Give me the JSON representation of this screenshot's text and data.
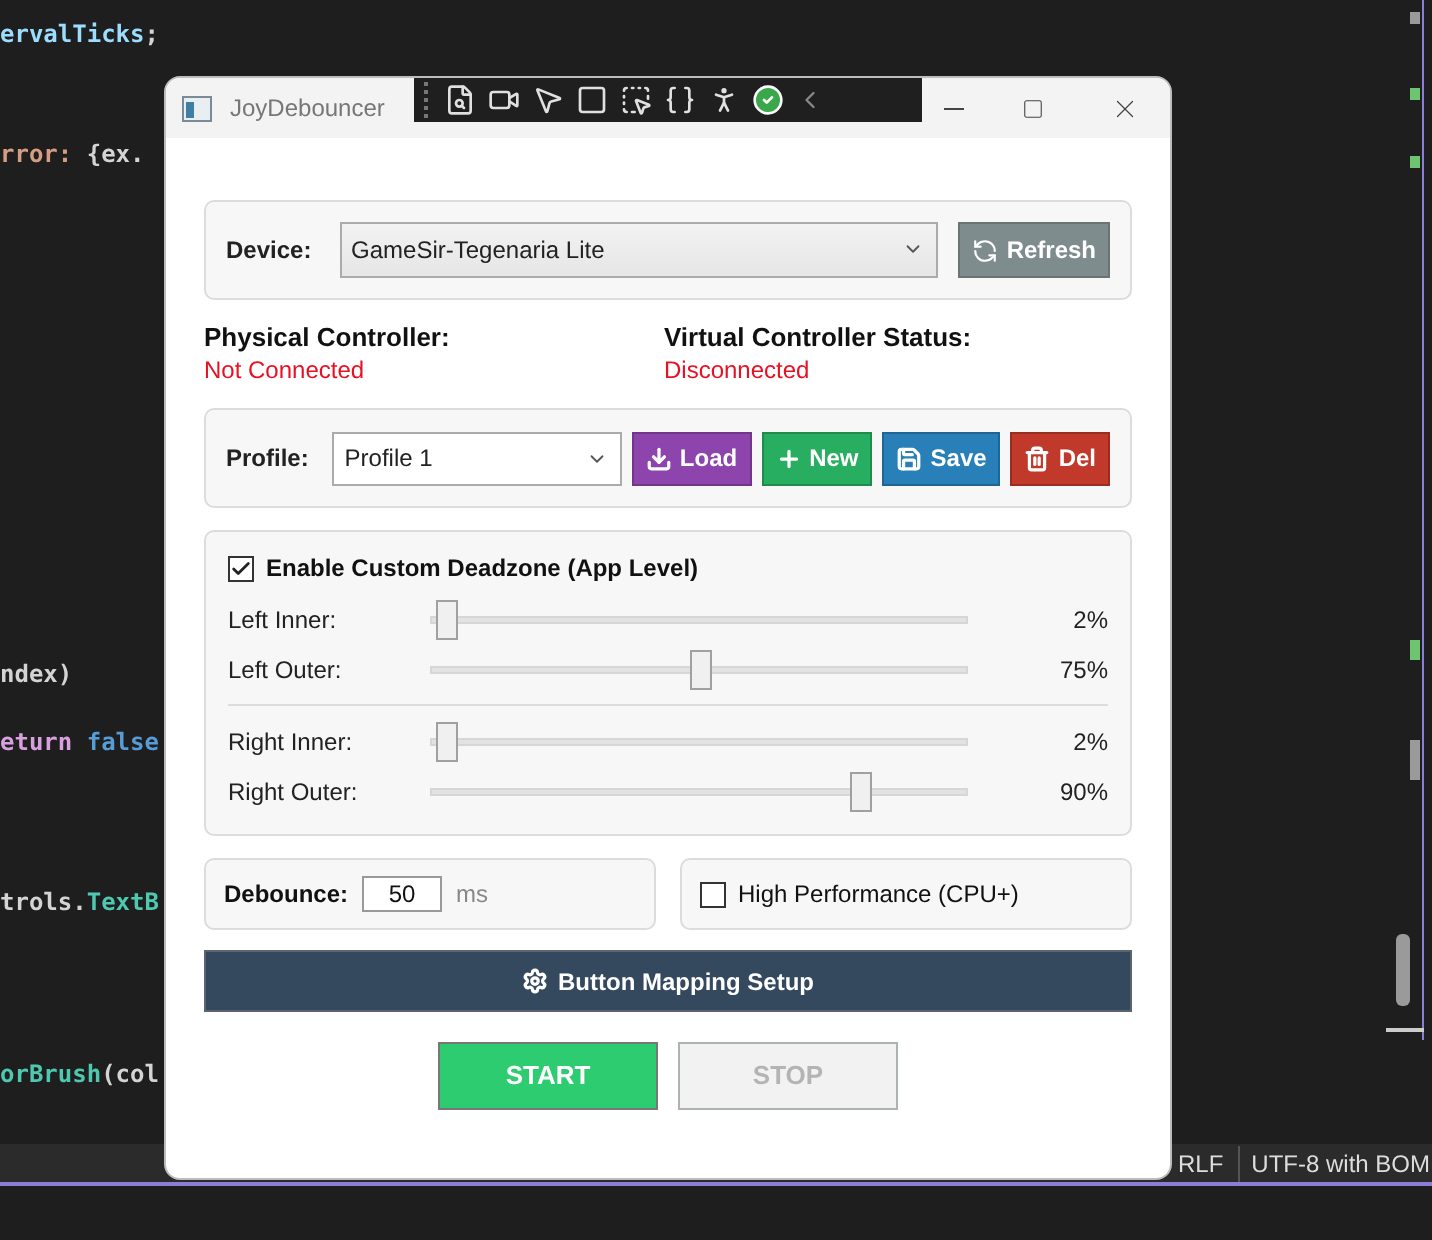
{
  "editor": {
    "code_lines": [
      {
        "segments": [
          {
            "text": "ervalTicks",
            "color": "#9cdcfe"
          },
          {
            "text": ";",
            "color": "#d4d4d4"
          }
        ]
      },
      {
        "segments": [
          {
            "text": "rror: ",
            "color": "#d69d85"
          },
          {
            "text": "{ex.",
            "color": "#d4d4d4"
          }
        ]
      },
      {
        "segments": [
          {
            "text": "ndex)",
            "color": "#d4d4d4"
          }
        ]
      },
      {
        "segments": [
          {
            "text": "eturn",
            "color": "#d8a0df"
          },
          {
            "text": " false",
            "color": "#569cd6"
          }
        ]
      },
      {
        "segments": [
          {
            "text": "trols.",
            "color": "#d4d4d4"
          },
          {
            "text": "TextB",
            "color": "#4ec9b0"
          }
        ]
      },
      {
        "segments": [
          {
            "text": "orBrush",
            "color": "#4ec9b0"
          },
          {
            "text": "(col",
            "color": "#d4d4d4"
          }
        ]
      }
    ],
    "status_bar": [
      "RLF",
      "UTF-8 with BOM"
    ]
  },
  "window": {
    "title": "JoyDebouncer"
  },
  "device": {
    "label": "Device:",
    "value": "GameSir-Tegenaria Lite",
    "refresh_button": "Refresh"
  },
  "status": [
    {
      "label": "Physical Controller:",
      "value": "Not Connected"
    },
    {
      "label": "Virtual Controller Status:",
      "value": "Disconnected"
    }
  ],
  "profile": {
    "label": "Profile:",
    "value": "Profile 1",
    "buttons": [
      {
        "kind": "load",
        "label": "Load"
      },
      {
        "kind": "new",
        "label": "New"
      },
      {
        "kind": "save",
        "label": "Save"
      },
      {
        "kind": "delete",
        "label": "Del"
      }
    ]
  },
  "deadzone": {
    "label": "Enable Custom Deadzone (App Level)",
    "checked": true,
    "groups": [
      {
        "sliders": [
          {
            "label": "Left Inner:",
            "level": 0.03,
            "reading": "2%"
          },
          {
            "label": "Left Outer:",
            "level": 0.5,
            "reading": "75%"
          }
        ]
      },
      {
        "sliders": [
          {
            "label": "Right Inner:",
            "level": 0.03,
            "reading": "2%"
          },
          {
            "label": "Right Outer:",
            "level": 0.8,
            "reading": "90%"
          }
        ]
      }
    ]
  },
  "debounce": {
    "label": "Debounce:",
    "value": "50",
    "unit": "ms"
  },
  "high_performance": {
    "label": "High Performance (CPU+)",
    "checked": false
  },
  "mapping_button": "Button Mapping Setup",
  "start_button": {
    "label": "START",
    "disabled": false
  },
  "stop_button": {
    "label": "STOP",
    "disabled": true
  }
}
